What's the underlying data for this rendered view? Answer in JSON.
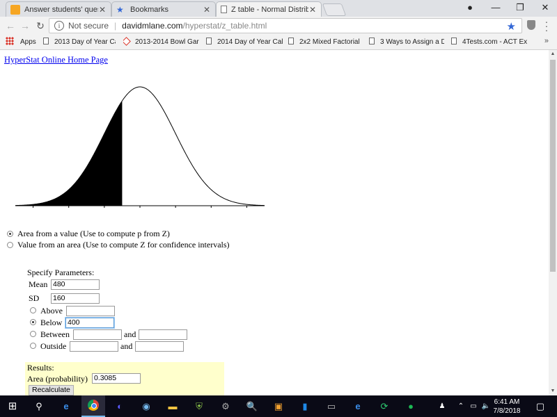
{
  "browser": {
    "tabs": [
      {
        "title": "Answer students' questio",
        "icon": "answer-site-icon"
      },
      {
        "title": "Bookmarks",
        "icon": "bookmark-star-icon"
      },
      {
        "title": "Z table - Normal Distribu",
        "icon": "page-icon",
        "active": true
      }
    ],
    "security_label": "Not secure",
    "url_host": "davidmlane.com",
    "url_path": "/hyperstat/z_table.html",
    "bookmarks": [
      {
        "label": "Apps"
      },
      {
        "label": "2013 Day of Year Ca"
      },
      {
        "label": "2013-2014 Bowl Gar"
      },
      {
        "label": "2014 Day of Year Cal"
      },
      {
        "label": "2x2 Mixed Factorial"
      },
      {
        "label": "3 Ways to Assign a D"
      },
      {
        "label": "4Tests.com - ACT Ex"
      }
    ]
  },
  "page": {
    "home_link": "HyperStat Online Home Page",
    "mode_options": [
      {
        "label": "Area from a value (Use to compute p from Z)",
        "selected": true
      },
      {
        "label": "Value from an area (Use to compute Z for confidence intervals)",
        "selected": false
      }
    ],
    "params_heading": "Specify Parameters:",
    "mean_label": "Mean",
    "mean_value": "480",
    "sd_label": "SD",
    "sd_value": "160",
    "above_label": "Above",
    "above_value": "",
    "below_label": "Below",
    "below_value": "400",
    "between_label": "Between",
    "between_low": "",
    "between_high": "",
    "and_label": "and",
    "outside_label": "Outside",
    "outside_low": "",
    "outside_high": "",
    "selected_region": "below",
    "results_heading": "Results:",
    "area_label": "Area (probability)",
    "area_value": "0.3085",
    "recalculate_label": "Recalculate"
  },
  "chart_data": {
    "type": "area",
    "distribution": "normal",
    "mean": 480,
    "sd": 160,
    "shaded_below": 400,
    "x_ticks": [
      "0",
      "160",
      "320",
      "480",
      "640",
      "800",
      "960"
    ],
    "xlim": [
      -80,
      1040
    ]
  },
  "taskbar": {
    "time": "6:41 AM",
    "date": "7/8/2018"
  }
}
